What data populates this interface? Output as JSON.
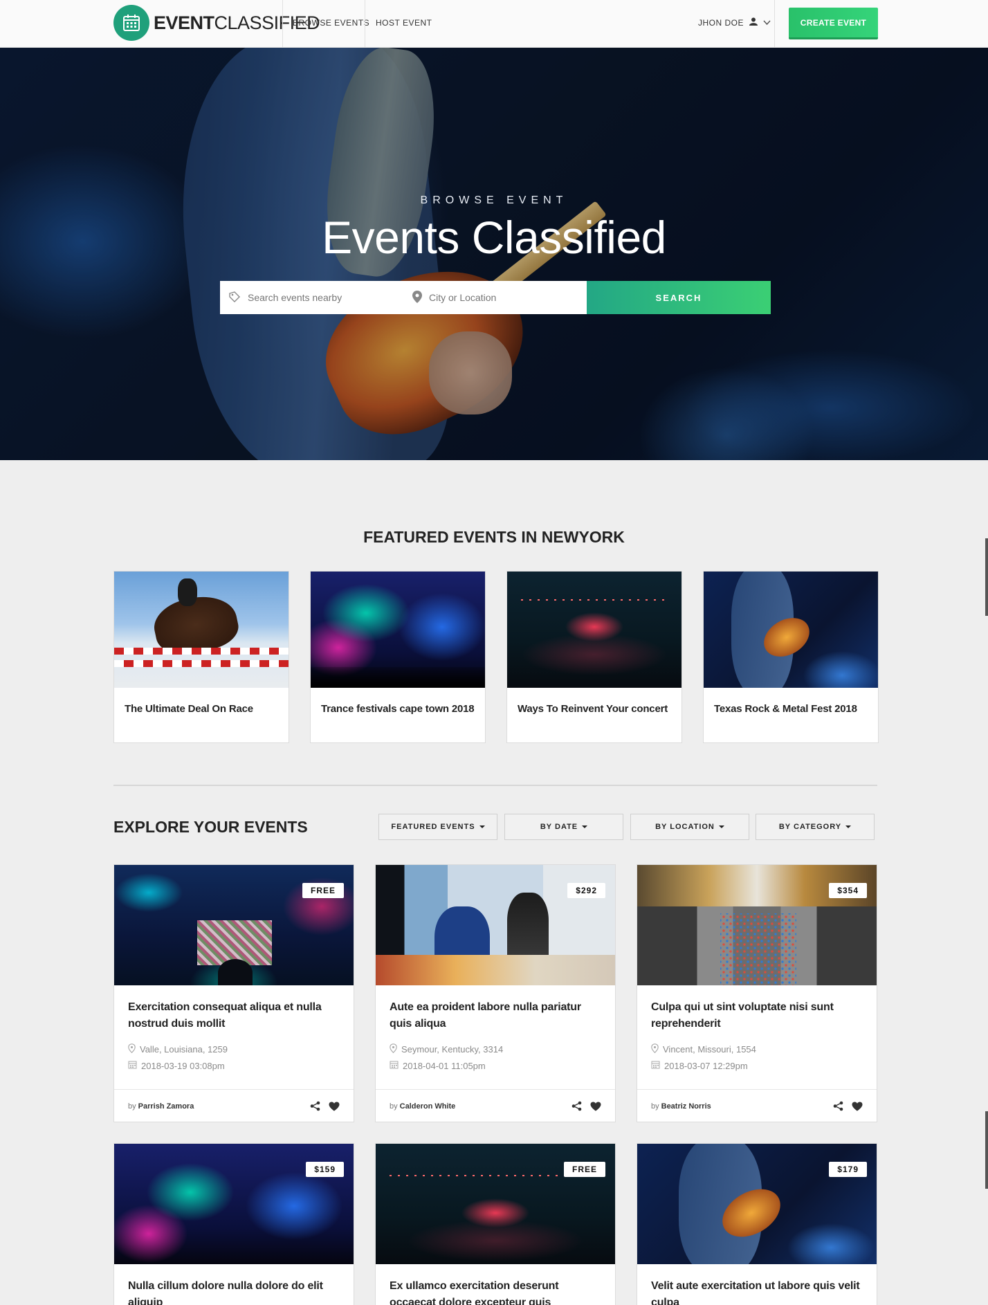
{
  "header": {
    "logo_bold": "EVENT",
    "logo_light": "CLASSIFIED",
    "nav": [
      "BROWSE EVENTS",
      "HOST EVENT"
    ],
    "user_name": "JHON DOE",
    "create_button": "CREATE EVENT"
  },
  "hero": {
    "subtitle": "BROWSE EVENT",
    "title": "Events Classified",
    "search_placeholder": "Search events nearby",
    "location_placeholder": "City or Location",
    "search_button": "SEARCH"
  },
  "featured": {
    "heading": "FEATURED EVENTS IN NEWYORK",
    "items": [
      {
        "title": "The Ultimate Deal On Race"
      },
      {
        "title": "Trance festivals cape town 2018"
      },
      {
        "title": "Ways To Reinvent Your concert"
      },
      {
        "title": "Texas Rock & Metal Fest 2018"
      }
    ]
  },
  "explore": {
    "heading": "EXPLORE YOUR EVENTS",
    "filters": [
      "FEATURED EVENTS",
      "BY DATE",
      "BY LOCATION",
      "BY CATEGORY"
    ],
    "by_label": "by",
    "events": [
      {
        "price": "FREE",
        "title": "Exercitation consequat aliqua et nulla nostrud duis mollit",
        "location": "Valle, Louisiana, 1259",
        "date": "2018-03-19 03:08pm",
        "author": "Parrish Zamora"
      },
      {
        "price": "$292",
        "title": "Aute ea proident labore nulla pariatur quis aliqua",
        "location": "Seymour, Kentucky, 3314",
        "date": "2018-04-01 11:05pm",
        "author": "Calderon White"
      },
      {
        "price": "$354",
        "title": "Culpa qui ut sint voluptate nisi sunt reprehenderit",
        "location": "Vincent, Missouri, 1554",
        "date": "2018-03-07 12:29pm",
        "author": "Beatriz Norris"
      },
      {
        "price": "$159",
        "title": "Nulla cillum dolore nulla dolore do elit aliquip"
      },
      {
        "price": "FREE",
        "title": "Ex ullamco exercitation deserunt occaecat dolore excepteur quis"
      },
      {
        "price": "$179",
        "title": "Velit aute exercitation ut labore quis velit culpa"
      }
    ]
  },
  "colors": {
    "accent_green": "#2ecc71",
    "accent_teal": "#1fa07b",
    "background": "#eeeeee"
  }
}
